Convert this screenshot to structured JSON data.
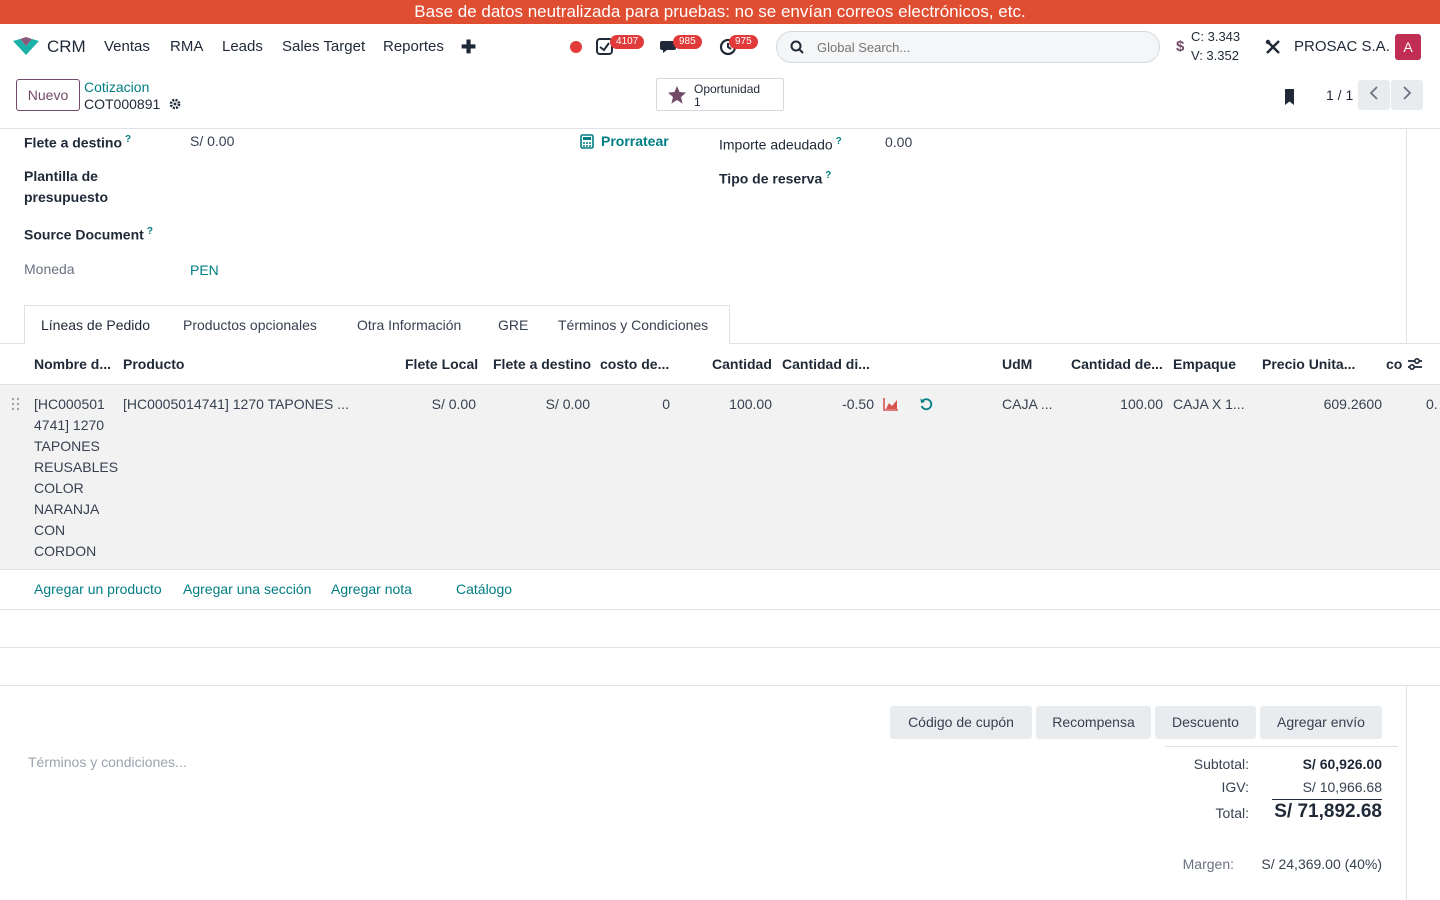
{
  "banner": {
    "text": "Base de datos neutralizada para pruebas: no se envían correos electrónicos, etc."
  },
  "navbar": {
    "app_name": "CRM",
    "menu": [
      "Ventas",
      "RMA",
      "Leads",
      "Sales Target",
      "Reportes"
    ],
    "badges": {
      "activities": "4107",
      "messages": "985",
      "timers": "975"
    },
    "search_placeholder": "Global Search...",
    "exchange_buy": "C: 3.343",
    "exchange_sell": "V: 3.352",
    "company": "PROSAC S.A.",
    "avatar_letter": "A"
  },
  "control": {
    "new_button": "Nuevo",
    "breadcrumb_parent": "Cotizacion",
    "record_name": "COT000891",
    "smart_button_label": "Oportunidad",
    "smart_button_count": "1",
    "pager": "1 / 1"
  },
  "form": {
    "flete_destino_label": "Flete a destino",
    "flete_destino_value": "S/ 0.00",
    "prorratear_label": "Prorratear",
    "importe_label": "Importe adeudado",
    "importe_value": "0.00",
    "plantilla_label_1": "Plantilla de",
    "plantilla_label_2": "presupuesto",
    "tipo_reserva_label": "Tipo de reserva",
    "source_doc_label": "Source Document",
    "moneda_label": "Moneda",
    "moneda_value": "PEN",
    "help_mark": "?"
  },
  "tabs": [
    "Líneas de Pedido",
    "Productos opcionales",
    "Otra Información",
    "GRE",
    "Términos y Condiciones"
  ],
  "table": {
    "headers": [
      "Nombre d...",
      "Producto",
      "Flete Local",
      "Flete a destino",
      "costo de...",
      "Cantidad",
      "Cantidad di...",
      "UdM",
      "Cantidad de...",
      "Empaque",
      "Precio Unita...",
      "co"
    ],
    "row": {
      "name_lines": [
        "[HC000501",
        "4741] 1270",
        "TAPONES",
        "REUSABLES",
        "COLOR",
        "NARANJA",
        "CON",
        "CORDON"
      ],
      "product": "[HC0005014741] 1270 TAPONES ...",
      "flete_local": "S/ 0.00",
      "flete_destino": "S/ 0.00",
      "costo": "0",
      "cantidad": "100.00",
      "cantidad_disp": "-0.50",
      "udm": "CAJA ...",
      "cantidad_emp": "100.00",
      "empaque": "CAJA X 1...",
      "precio": "609.2600",
      "extra": "0."
    },
    "actions": [
      "Agregar un producto",
      "Agregar una sección",
      "Agregar nota",
      "Catálogo"
    ]
  },
  "footer": {
    "buttons": [
      "Código de cupón",
      "Recompensa",
      "Descuento",
      "Agregar envío"
    ],
    "terms_placeholder": "Términos y condiciones...",
    "subtotal_label": "Subtotal:",
    "subtotal_value": "S/ 60,926.00",
    "igv_label": "IGV:",
    "igv_value": "S/ 10,966.68",
    "total_label": "Total:",
    "total_value": "S/ 71,892.68",
    "margin_label": "Margen:",
    "margin_value": "S/ 24,369.00 (40%)"
  },
  "colors": {
    "brand": "#714b67",
    "link": "#017e84",
    "banner": "#e04e32",
    "badge": "#e03a3a"
  }
}
